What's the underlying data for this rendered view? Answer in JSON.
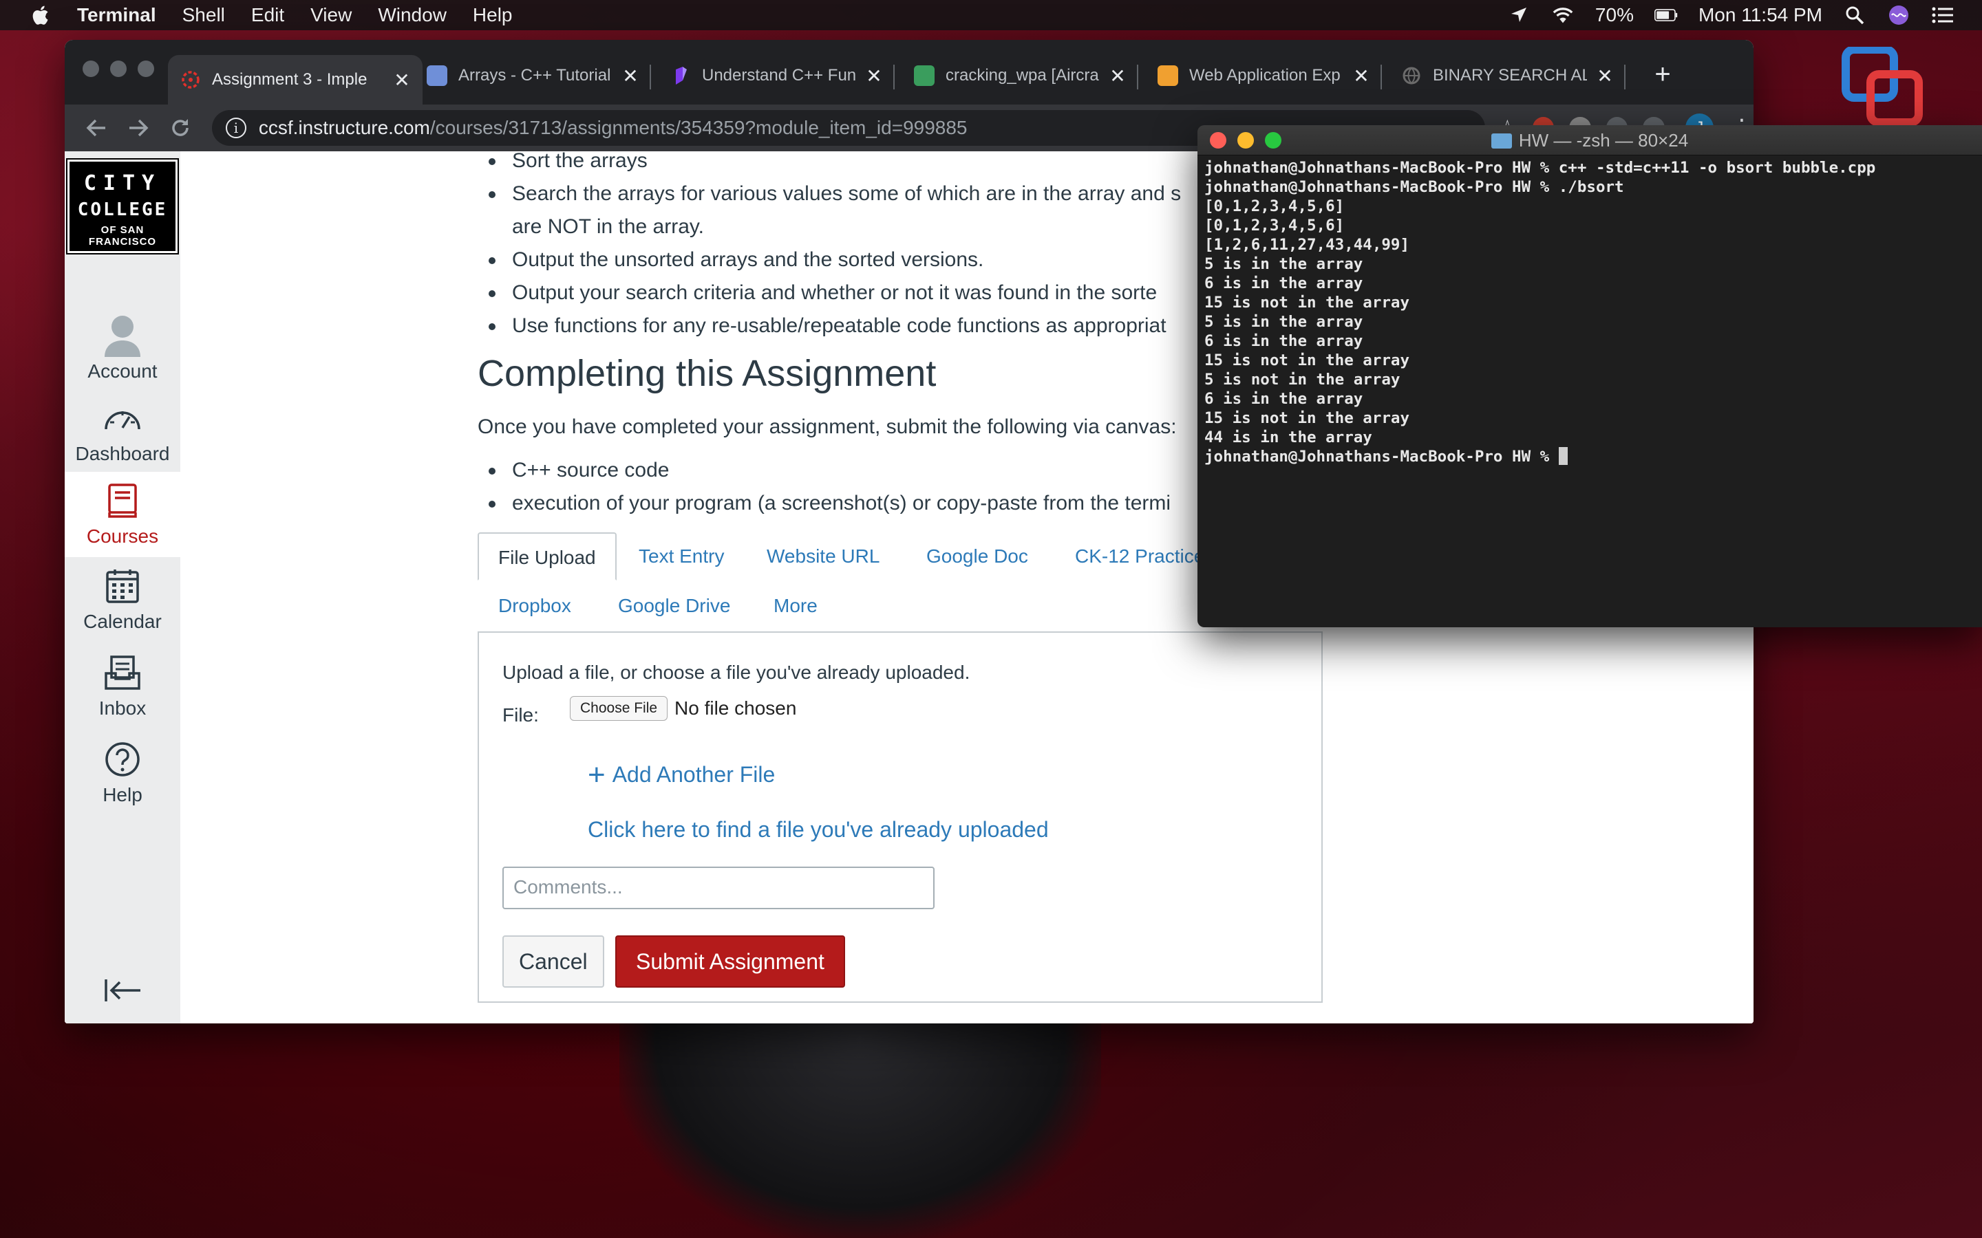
{
  "menubar": {
    "app_name": "Terminal",
    "items": [
      "Shell",
      "Edit",
      "View",
      "Window",
      "Help"
    ],
    "battery": "70%",
    "clock": "Mon 11:54 PM"
  },
  "chrome": {
    "tabs": [
      {
        "title": "Assignment 3 - Imple",
        "fav_color": "#e0302b"
      },
      {
        "title": "Arrays - C++ Tutorial",
        "fav_color": "#6f8fd8"
      },
      {
        "title": "Understand C++ Fun",
        "fav_color": "#7c3aed"
      },
      {
        "title": "cracking_wpa [Aircra",
        "fav_color": "#3a9d5d"
      },
      {
        "title": "Web Application Exp",
        "fav_color": "#f0a030"
      },
      {
        "title": "BINARY SEARCH ALG",
        "fav_color": "#8a8a8a"
      }
    ],
    "url_host": "ccsf.instructure.com",
    "url_path": "/courses/31713/assignments/354359?module_item_id=999885",
    "profile_initial": "J"
  },
  "canvas": {
    "logo": {
      "line1": "CITY",
      "line2": "COLLEGE",
      "line3": "OF SAN FRANCISCO"
    },
    "nav": [
      "Account",
      "Dashboard",
      "Courses",
      "Calendar",
      "Inbox",
      "Help"
    ],
    "bullets_top": [
      "Sort the arrays",
      "Search the arrays for various values some of which are in the array and s",
      "are NOT in the array.",
      "Output the unsorted arrays and the sorted versions.",
      "Output your search criteria and whether or not it was found in the sorte",
      "Use functions for any re-usable/repeatable code functions as appropriat"
    ],
    "heading": "Completing this Assignment",
    "intro": "Once you have completed your assignment, submit the following via canvas:",
    "bullets_submit": [
      "C++ source code",
      "execution of your program (a screenshot(s) or copy-paste from the termi"
    ],
    "submit_tabs": [
      "File Upload",
      "Text Entry",
      "Website URL",
      "Google Doc",
      "CK-12 Practice",
      "Dropbox",
      "Google Drive",
      "More"
    ],
    "upload": {
      "intro": "Upload a file, or choose a file you've already uploaded.",
      "file_label": "File:",
      "choose_button": "Choose File",
      "no_file": "No file chosen",
      "add_another": "Add Another File",
      "find_uploaded": "Click here to find a file you've already uploaded",
      "comments_placeholder": "Comments...",
      "cancel": "Cancel",
      "submit": "Submit Assignment"
    }
  },
  "terminal": {
    "title": "HW — -zsh — 80×24",
    "lines": [
      "johnathan@Johnathans-MacBook-Pro HW % c++ -std=c++11 -o bsort bubble.cpp",
      "johnathan@Johnathans-MacBook-Pro HW % ./bsort",
      "[0,1,2,3,4,5,6]",
      "[0,1,2,3,4,5,6]",
      "[1,2,6,11,27,43,44,99]",
      "5 is in the array",
      "6 is in the array",
      "15 is not in the array",
      "5 is in the array",
      "6 is in the array",
      "15 is not in the array",
      "5 is not in the array",
      "6 is in the array",
      "15 is not in the array",
      "44 is in the array"
    ],
    "prompt": "johnathan@Johnathans-MacBook-Pro HW % "
  }
}
